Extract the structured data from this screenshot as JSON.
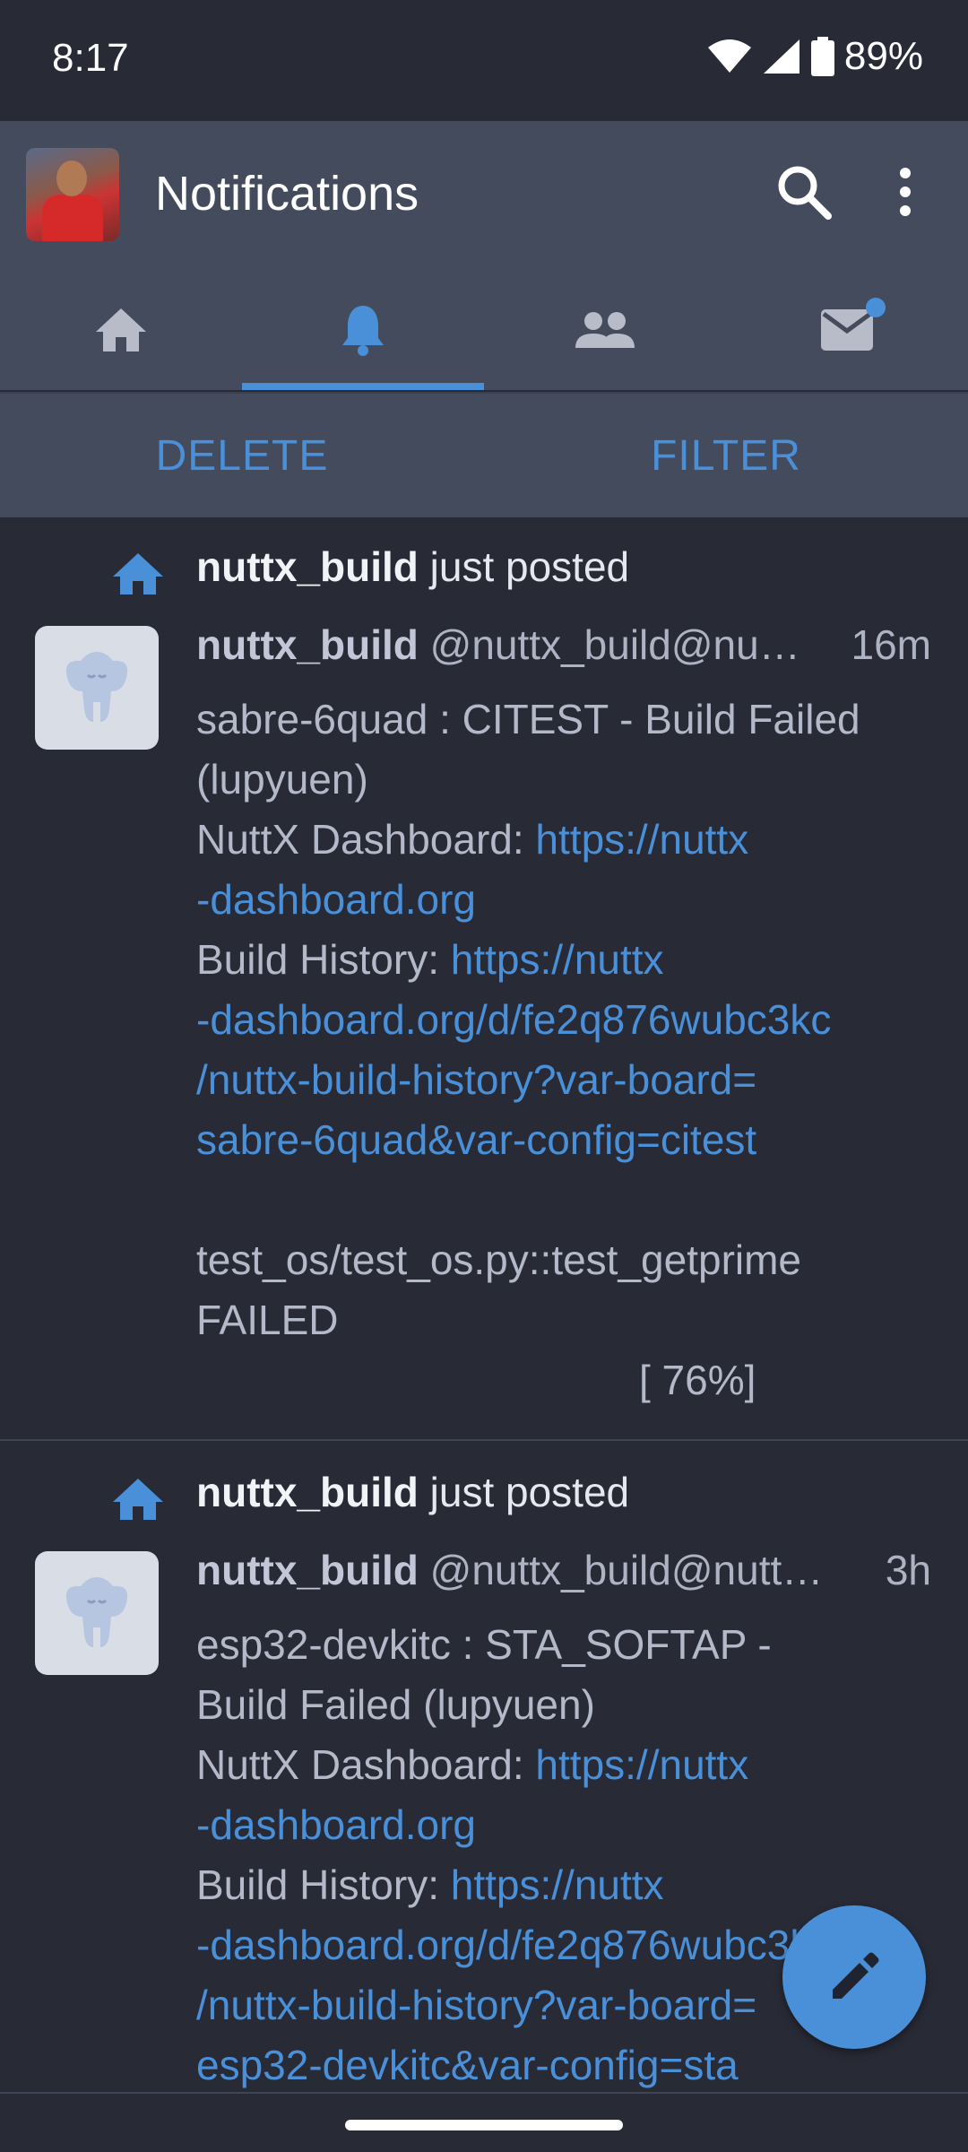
{
  "status": {
    "time": "8:17",
    "battery": "89%"
  },
  "appbar": {
    "title": "Notifications"
  },
  "tabs": [
    {
      "name": "home",
      "icon": "home-icon",
      "active": false
    },
    {
      "name": "notifications",
      "icon": "bell-icon",
      "active": true
    },
    {
      "name": "people",
      "icon": "people-icon",
      "active": false
    },
    {
      "name": "messages",
      "icon": "mail-icon",
      "active": false,
      "badge": true
    }
  ],
  "actions": {
    "delete": "DELETE",
    "filter": "FILTER"
  },
  "notifications": [
    {
      "user_bold": "nuttx_build",
      "action": " just posted",
      "display_name": "nuttx_build",
      "handle": "@nuttx_build@nu…",
      "time": "16m",
      "line1": "sabre-6quad : CITEST - Build Failed",
      "line2": "(lupyuen)",
      "dash_label": "NuttX Dashboard: ",
      "dash_link1": "https://nuttx",
      "dash_link2": "-dashboard.org",
      "hist_label": "Build History: ",
      "hist_link1": "https://nuttx",
      "hist_link2": "-dashboard.org/d/fe2q876wubc3kc",
      "hist_link3": "/nuttx-build-history?var-board=",
      "hist_link4": "sabre-6quad&var-config=citest",
      "extra1": "test_os/test_os.py::test_getprime",
      "extra2": "FAILED",
      "extra3": "[ 76%]"
    },
    {
      "user_bold": "nuttx_build",
      "action": " just posted",
      "display_name": "nuttx_build",
      "handle": "@nuttx_build@nutt…",
      "time": "3h",
      "line1": "esp32-devkitc : STA_SOFTAP -",
      "line2": "Build Failed (lupyuen)",
      "dash_label": "NuttX Dashboard: ",
      "dash_link1": "https://nuttx",
      "dash_link2": "-dashboard.org",
      "hist_label": "Build History: ",
      "hist_link1": "https://nuttx",
      "hist_link2": "-dashboard.org/d/fe2q876wubc3kc",
      "hist_link3": "/nuttx-build-history?var-board=",
      "hist_link4": "esp32-devkitc&var-config=sta"
    }
  ],
  "colors": {
    "accent": "#4a90d9",
    "background": "#282a36",
    "bar": "#444b5d"
  }
}
